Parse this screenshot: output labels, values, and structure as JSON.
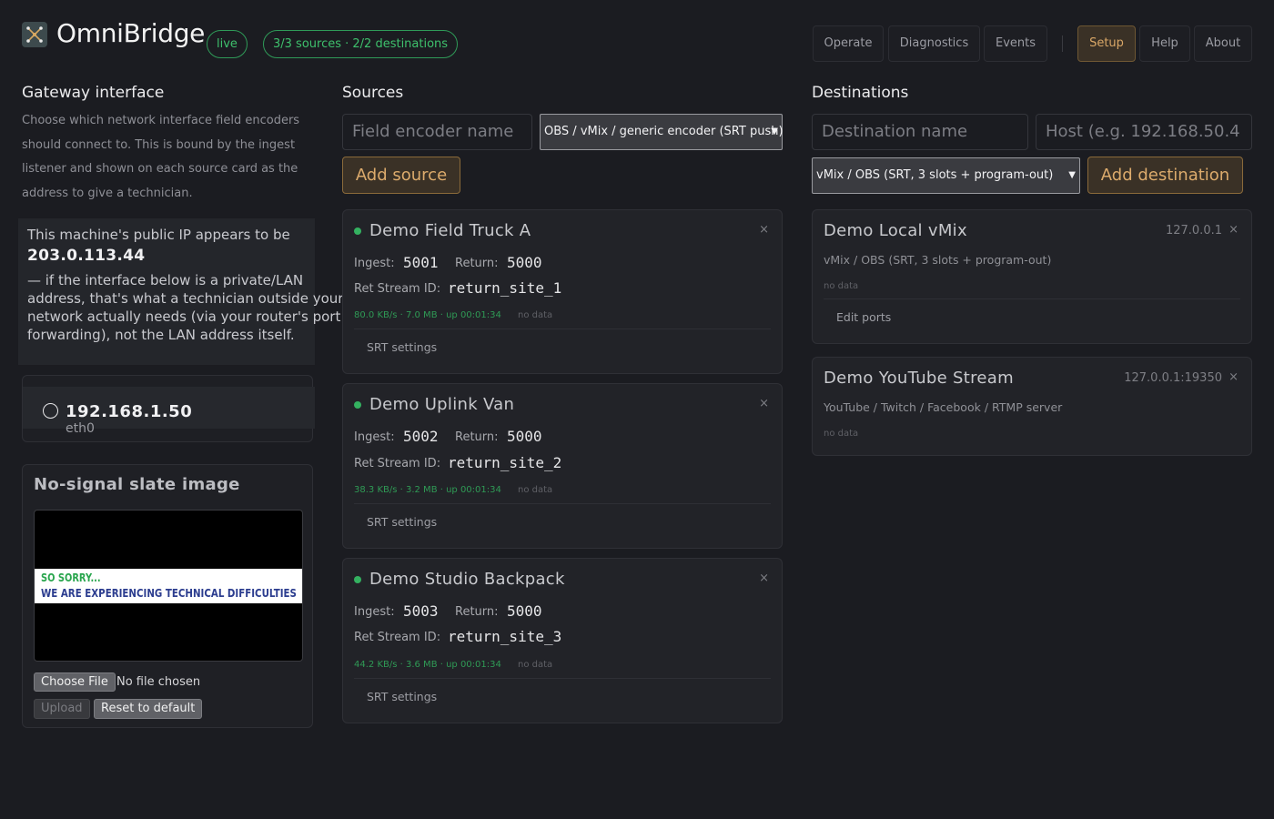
{
  "header": {
    "brand": "OmniBridge",
    "status_pill": "live",
    "summary_pill": "3/3 sources · 2/2 destinations",
    "nav": [
      "Operate",
      "Diagnostics",
      "Events",
      "Setup",
      "Help",
      "About"
    ],
    "active_nav": "Setup"
  },
  "gateway": {
    "title": "Gateway interface",
    "description": "Choose which network interface field encoders should connect to. This is bound by the ingest listener and shown on each source card as the address to give a technician.",
    "public_ip_prefix": "This machine's public IP appears to be",
    "public_ip": "203.0.113.44",
    "public_ip_note": "— if the interface below is a private/LAN address, that's what a technician outside your network actually needs (via your router's port forwarding), not the LAN address itself.",
    "interface": {
      "ip": "192.168.1.50",
      "name": "eth0",
      "selected": false
    }
  },
  "slate": {
    "title": "No-signal slate image",
    "image_line1": "SO SORRY...",
    "image_line2": "WE ARE EXPERIENCING TECHNICAL DIFFICULTIES",
    "choose_file_label": "Choose File",
    "no_file_text": "No file chosen",
    "upload_label": "Upload",
    "reset_label": "Reset to default"
  },
  "sources": {
    "title": "Sources",
    "name_placeholder": "Field encoder name",
    "type_selected": "OBS / vMix / generic encoder (SRT push)",
    "add_label": "Add source",
    "ingest_label": "Ingest:",
    "return_label": "Return:",
    "stream_id_label": "Ret Stream ID:",
    "srt_settings_label": "SRT settings",
    "cards": [
      {
        "name": "Demo Field Truck A",
        "ingest": "5001",
        "return": "5000",
        "stream_id": "return_site_1",
        "stats": "80.0 KB/s · 7.0 MB · up 00:01:34",
        "nodata": "no data"
      },
      {
        "name": "Demo Uplink Van",
        "ingest": "5002",
        "return": "5000",
        "stream_id": "return_site_2",
        "stats": "38.3 KB/s · 3.2 MB · up 00:01:34",
        "nodata": "no data"
      },
      {
        "name": "Demo Studio Backpack",
        "ingest": "5003",
        "return": "5000",
        "stream_id": "return_site_3",
        "stats": "44.2 KB/s · 3.6 MB · up 00:01:34",
        "nodata": "no data"
      }
    ]
  },
  "destinations": {
    "title": "Destinations",
    "name_placeholder": "Destination name",
    "host_placeholder": "Host (e.g. 192.168.50.4",
    "type_selected": "vMix / OBS (SRT, 3 slots + program-out)",
    "add_label": "Add destination",
    "cards": [
      {
        "name": "Demo Local vMix",
        "host": "127.0.0.1",
        "type": "vMix / OBS (SRT, 3 slots + program-out)",
        "nodata": "no data",
        "action": "Edit ports"
      },
      {
        "name": "Demo YouTube Stream",
        "host": "127.0.0.1:19350",
        "type": "YouTube / Twitch / Facebook / RTMP server",
        "nodata": "no data"
      }
    ]
  },
  "close_glyph": "×",
  "colors": {
    "accent": "#dcab6c",
    "live": "#3ec06c",
    "background": "#1b1c21"
  }
}
